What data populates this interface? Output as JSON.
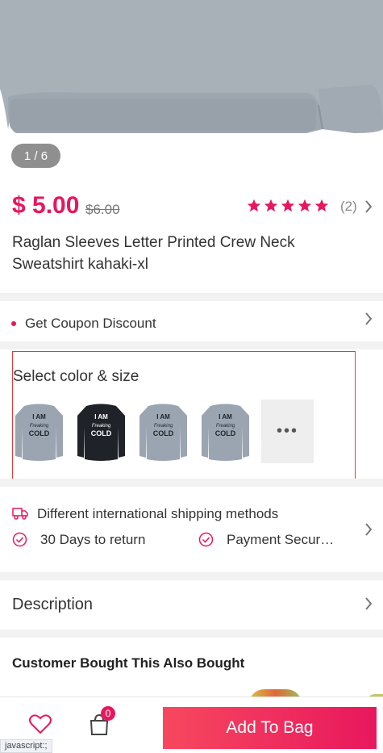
{
  "gallery": {
    "page_indicator": "1 / 6"
  },
  "product": {
    "price": "$ 5.00",
    "original_price": "$6.00",
    "rating": 5,
    "review_count": "(2)",
    "title": "Raglan Sleeves Letter Printed Crew Neck Sweatshirt kahaki-xl"
  },
  "coupon": {
    "label": "Get Coupon Discount"
  },
  "variants": {
    "title": "Select color & size",
    "thumbs": [
      {
        "shirt_color": "#9aa5b1",
        "print": [
          "I AM",
          "Freaking",
          "COLD"
        ]
      },
      {
        "shirt_color": "#1f2329",
        "print": [
          "I AM",
          "Freaking",
          "COLD"
        ]
      },
      {
        "shirt_color": "#9aa5b1",
        "print": [
          "I AM",
          "Freaking",
          "COLD"
        ]
      },
      {
        "shirt_color": "#9aa5b1",
        "print": [
          "I AM",
          "Freaking",
          "COLD"
        ]
      }
    ],
    "more_label": "•••"
  },
  "services": {
    "shipping": "Different international shipping methods",
    "returns": "30 Days to return",
    "payment": "Payment Secur…"
  },
  "description": {
    "label": "Description"
  },
  "also_bought": {
    "title": "Customer Bought This Also Bought"
  },
  "bottom_bar": {
    "bag_count": "0",
    "add_to_bag": "Add To Bag"
  },
  "status_bar": {
    "text": "javascript:;"
  },
  "colors": {
    "accent": "#e8175d",
    "star": "#e8175d"
  }
}
